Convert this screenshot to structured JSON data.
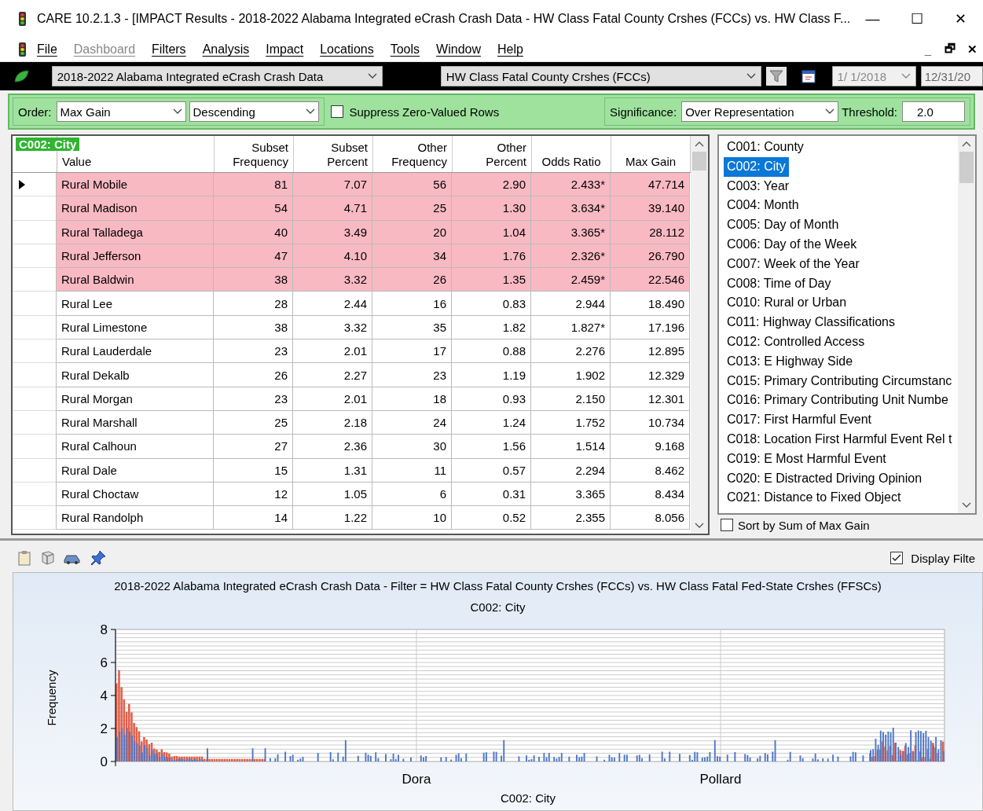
{
  "window": {
    "title": "CARE 10.2.1.3 - [IMPACT Results - 2018-2022 Alabama Integrated eCrash Crash Data - HW Class Fatal County Crshes (FCCs) vs. HW Class F...",
    "controls": [
      "—",
      "☐",
      "✕"
    ]
  },
  "menu": {
    "items": [
      {
        "label": "File",
        "disabled": false
      },
      {
        "label": "Dashboard",
        "disabled": true
      },
      {
        "label": "Filters",
        "disabled": false
      },
      {
        "label": "Analysis",
        "disabled": false
      },
      {
        "label": "Impact",
        "disabled": false
      },
      {
        "label": "Locations",
        "disabled": false
      },
      {
        "label": "Tools",
        "disabled": false
      },
      {
        "label": "Window",
        "disabled": false
      },
      {
        "label": "Help",
        "disabled": false
      }
    ],
    "child_controls": [
      "_",
      "🗗",
      "✕"
    ]
  },
  "data_bar": {
    "dataset": "2018-2022 Alabama Integrated eCrash Crash Data",
    "filter": "HW Class Fatal County Crshes (FCCs)",
    "start_date": "1/ 1/2018",
    "end_date": "12/31/20"
  },
  "options": {
    "order_label": "Order:",
    "order": "Max Gain",
    "direction": "Descending",
    "suppress_zero": {
      "label": "Suppress Zero-Valued Rows",
      "checked": false
    },
    "significance_label": "Significance:",
    "significance": "Over Representation",
    "threshold_label": "Threshold:",
    "threshold": "2.0"
  },
  "table": {
    "badge": "C002: City",
    "columns": [
      "Value",
      "Subset Frequency",
      "Subset Percent",
      "Other Frequency",
      "Other Percent",
      "Odds Ratio",
      "Max Gain"
    ],
    "rows": [
      {
        "cells": [
          "Rural Mobile",
          "81",
          "7.07",
          "56",
          "2.90",
          "2.433*",
          "47.714"
        ],
        "significant": true,
        "current": true
      },
      {
        "cells": [
          "Rural Madison",
          "54",
          "4.71",
          "25",
          "1.30",
          "3.634*",
          "39.140"
        ],
        "significant": true,
        "current": false
      },
      {
        "cells": [
          "Rural Talladega",
          "40",
          "3.49",
          "20",
          "1.04",
          "3.365*",
          "28.112"
        ],
        "significant": true,
        "current": false
      },
      {
        "cells": [
          "Rural Jefferson",
          "47",
          "4.10",
          "34",
          "1.76",
          "2.326*",
          "26.790"
        ],
        "significant": true,
        "current": false
      },
      {
        "cells": [
          "Rural Baldwin",
          "38",
          "3.32",
          "26",
          "1.35",
          "2.459*",
          "22.546"
        ],
        "significant": true,
        "current": false
      },
      {
        "cells": [
          "Rural Lee",
          "28",
          "2.44",
          "16",
          "0.83",
          "2.944",
          "18.490"
        ],
        "significant": false,
        "current": false
      },
      {
        "cells": [
          "Rural Limestone",
          "38",
          "3.32",
          "35",
          "1.82",
          "1.827*",
          "17.196"
        ],
        "significant": false,
        "current": false
      },
      {
        "cells": [
          "Rural Lauderdale",
          "23",
          "2.01",
          "17",
          "0.88",
          "2.276",
          "12.895"
        ],
        "significant": false,
        "current": false
      },
      {
        "cells": [
          "Rural Dekalb",
          "26",
          "2.27",
          "23",
          "1.19",
          "1.902",
          "12.329"
        ],
        "significant": false,
        "current": false
      },
      {
        "cells": [
          "Rural Morgan",
          "23",
          "2.01",
          "18",
          "0.93",
          "2.150",
          "12.301"
        ],
        "significant": false,
        "current": false
      },
      {
        "cells": [
          "Rural Marshall",
          "25",
          "2.18",
          "24",
          "1.24",
          "1.752",
          "10.734"
        ],
        "significant": false,
        "current": false
      },
      {
        "cells": [
          "Rural Calhoun",
          "27",
          "2.36",
          "30",
          "1.56",
          "1.514",
          "9.168"
        ],
        "significant": false,
        "current": false
      },
      {
        "cells": [
          "Rural Dale",
          "15",
          "1.31",
          "11",
          "0.57",
          "2.294",
          "8.462"
        ],
        "significant": false,
        "current": false
      },
      {
        "cells": [
          "Rural Choctaw",
          "12",
          "1.05",
          "6",
          "0.31",
          "3.365",
          "8.434"
        ],
        "significant": false,
        "current": false
      },
      {
        "cells": [
          "Rural Randolph",
          "14",
          "1.22",
          "10",
          "0.52",
          "2.355",
          "8.056"
        ],
        "significant": false,
        "current": false
      }
    ]
  },
  "variables": {
    "items": [
      {
        "label": "C001: County",
        "selected": false
      },
      {
        "label": "C002: City",
        "selected": true
      },
      {
        "label": "C003: Year",
        "selected": false
      },
      {
        "label": "C004: Month",
        "selected": false
      },
      {
        "label": "C005: Day of Month",
        "selected": false
      },
      {
        "label": "C006: Day of the Week",
        "selected": false
      },
      {
        "label": "C007: Week of the Year",
        "selected": false
      },
      {
        "label": "C008: Time of Day",
        "selected": false
      },
      {
        "label": "C010: Rural or Urban",
        "selected": false
      },
      {
        "label": "C011: Highway Classifications",
        "selected": false
      },
      {
        "label": "C012: Controlled Access",
        "selected": false
      },
      {
        "label": "C013: E Highway Side",
        "selected": false
      },
      {
        "label": "C015: Primary Contributing Circumstanc",
        "selected": false
      },
      {
        "label": "C016: Primary Contributing Unit Numbe",
        "selected": false
      },
      {
        "label": "C017: First Harmful Event",
        "selected": false
      },
      {
        "label": "C018: Location First Harmful Event Rel t",
        "selected": false
      },
      {
        "label": "C019: E Most Harmful Event",
        "selected": false
      },
      {
        "label": "C020: E Distracted Driving Opinion",
        "selected": false
      },
      {
        "label": "C021: Distance to Fixed Object",
        "selected": false
      }
    ],
    "sort_by_sum": {
      "label": "Sort by Sum of Max Gain",
      "checked": false
    }
  },
  "chart_panel": {
    "display_filter": {
      "label": "Display Filte",
      "checked": true
    },
    "title": "2018-2022 Alabama Integrated eCrash Crash Data - Filter = HW Class Fatal County Crshes (FCCs) vs. HW Class Fatal Fed-State Crshes (FFSCs)",
    "subtitle": "C002: City",
    "ylabel": "Frequency",
    "xlabel": "C002: City",
    "yticks": [
      "8",
      "6",
      "4",
      "2",
      "0"
    ],
    "xlabels": [
      "Dora",
      "Pollard"
    ]
  }
}
